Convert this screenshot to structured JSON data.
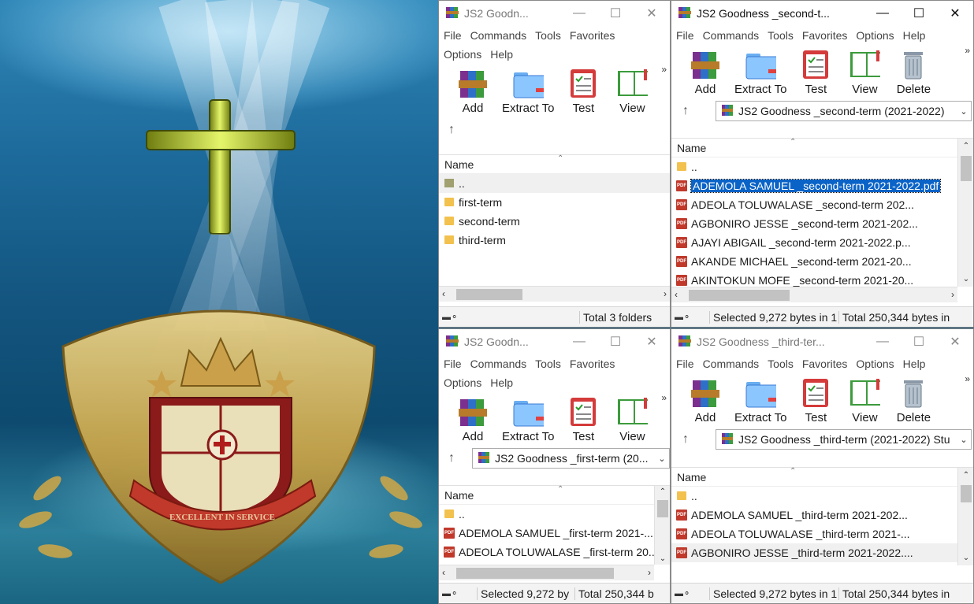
{
  "wallpaper": {
    "motto": "EXCELLENT IN SERVICE"
  },
  "menu_common": [
    "File",
    "Commands",
    "Tools",
    "Favorites",
    "Options",
    "Help"
  ],
  "tools": {
    "add": "Add",
    "extract": "Extract To",
    "test": "Test",
    "view": "View",
    "delete": "Delete"
  },
  "column_name": "Name",
  "windows": {
    "root": {
      "title": "JS2 Goodn...",
      "items": [
        "..",
        "first-term",
        "second-term",
        "third-term"
      ],
      "status": {
        "info": "Total 3 folders"
      }
    },
    "second": {
      "title": "JS2 Goodness _second-t...",
      "address": "JS2 Goodness _second-term (2021-2022)",
      "items": [
        "..",
        "ADEMOLA SAMUEL _second-term 2021-2022.pdf",
        "ADEOLA TOLUWALASE _second-term 202...",
        "AGBONIRO JESSE _second-term 2021-202...",
        "AJAYI ABIGAIL _second-term 2021-2022.p...",
        "AKANDE MICHAEL _second-term 2021-20...",
        "AKINTOKUN MOFE _second-term 2021-20..."
      ],
      "status": {
        "selected": "Selected 9,272 bytes in 1",
        "total": "Total 250,344 bytes in"
      }
    },
    "first": {
      "title": "JS2 Goodn...",
      "address": "JS2 Goodness _first-term (20...",
      "items": [
        "..",
        "ADEMOLA SAMUEL _first-term 2021-...",
        "ADEOLA TOLUWALASE _first-term 20..."
      ],
      "status": {
        "selected": "Selected 9,272 by",
        "total": "Total 250,344 b"
      }
    },
    "third": {
      "title": "JS2 Goodness _third-ter...",
      "address": "JS2 Goodness _third-term (2021-2022) Stu",
      "items": [
        "..",
        "ADEMOLA SAMUEL _third-term 2021-202...",
        "ADEOLA TOLUWALASE _third-term 2021-...",
        "AGBONIRO JESSE _third-term 2021-2022...."
      ],
      "status": {
        "selected": "Selected 9,272 bytes in 1",
        "total": "Total 250,344 bytes in"
      }
    }
  }
}
